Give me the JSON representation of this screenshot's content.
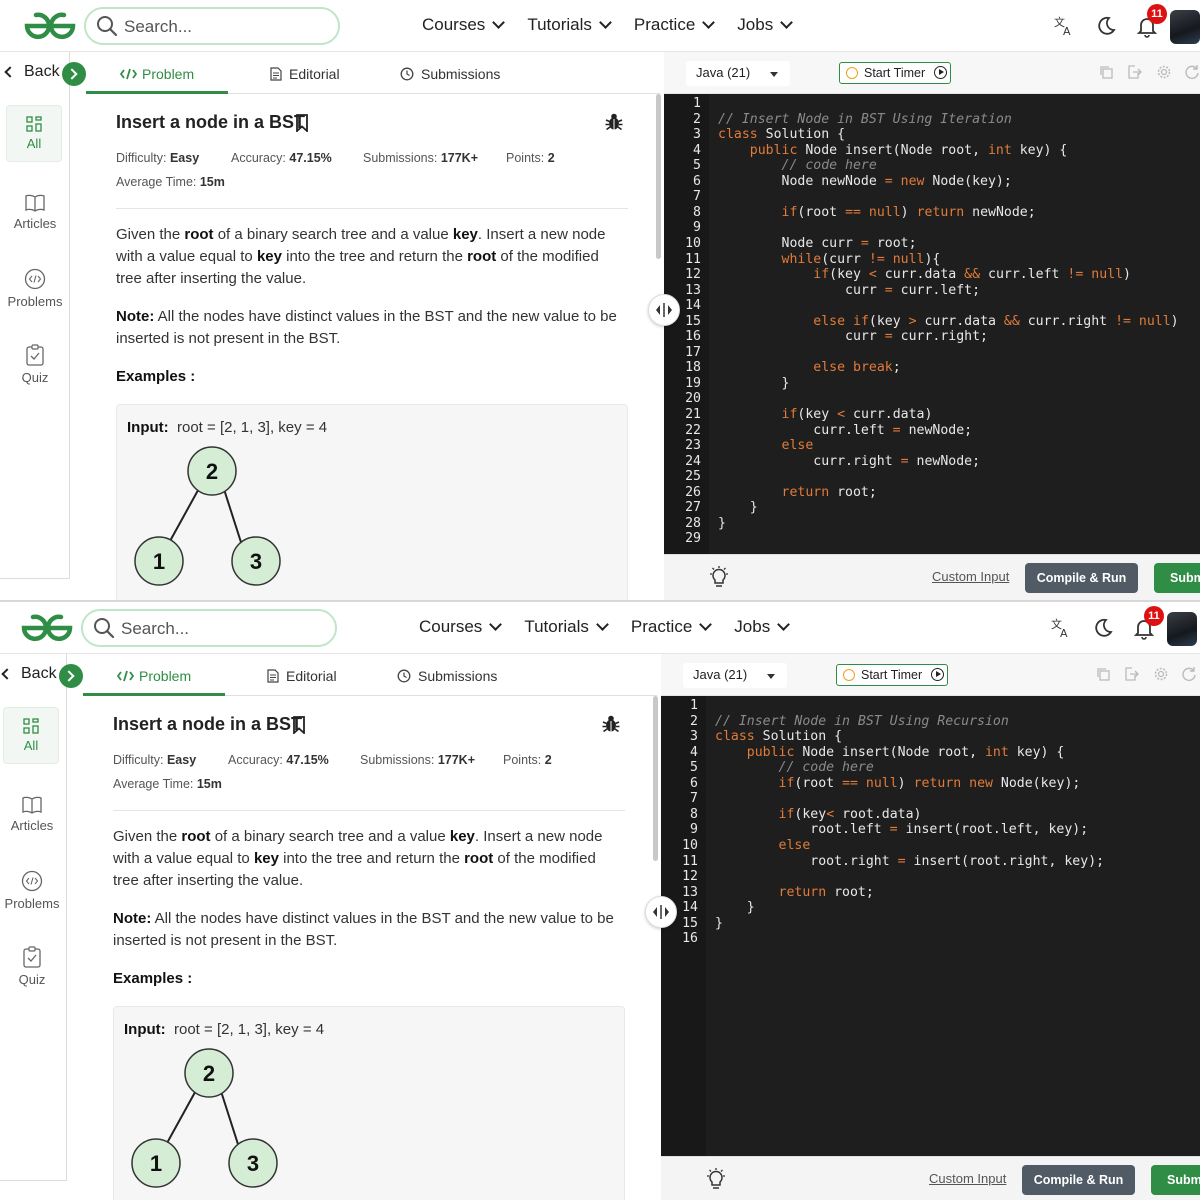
{
  "shots": [
    {
      "header": {
        "search_placeholder": "Search...",
        "nav": [
          "Courses",
          "Tutorials",
          "Practice",
          "Jobs"
        ],
        "notification_count": "11"
      },
      "sidebar": {
        "back_label": "Back",
        "items": [
          "All",
          "Articles",
          "Problems",
          "Quiz"
        ]
      },
      "tabs": [
        "Problem",
        "Editorial",
        "Submissions"
      ],
      "problem": {
        "title": "Insert a node in a BST",
        "difficulty_label": "Difficulty:",
        "difficulty": "Easy",
        "accuracy_label": "Accuracy:",
        "accuracy": "47.15%",
        "submissions_label": "Submissions:",
        "submissions": "177K+",
        "points_label": "Points:",
        "points": "2",
        "avg_time_label": "Average Time:",
        "avg_time": "15m",
        "desc": [
          "Given the ",
          "root",
          " of a binary search tree and a value ",
          "key",
          ". Insert a new node with a value equal to ",
          "key",
          " into the tree and return the ",
          "root",
          " of the modified tree after inserting the value."
        ],
        "note_label": "Note:",
        "note": " All the nodes have distinct values in the BST and the new value to be inserted is not present in the BST.",
        "examples_label": "Examples :",
        "example_input_label": "Input:",
        "example_input": "root = [2, 1, 3], key = 4",
        "tree_nodes": [
          "2",
          "1",
          "3"
        ]
      },
      "editor": {
        "language": "Java (21)",
        "timer_label": "Start Timer",
        "custom_input": "Custom Input",
        "compile_run": "Compile & Run",
        "submit": "Submit",
        "code": [
          "",
          "// Insert Node in BST Using Iteration",
          "class Solution {",
          "    public Node insert(Node root, int key) {",
          "        // code here",
          "        Node newNode = new Node(key);",
          "",
          "        if(root == null) return newNode;",
          "",
          "        Node curr = root;",
          "        while(curr != null){",
          "            if(key < curr.data && curr.left != null)",
          "                curr = curr.left;",
          "",
          "            else if(key > curr.data && curr.right != null)",
          "                curr = curr.right;",
          "",
          "            else break;",
          "        }",
          "",
          "        if(key < curr.data)",
          "            curr.left = newNode;",
          "        else",
          "            curr.right = newNode;",
          "",
          "        return root;",
          "    }",
          "}",
          ""
        ]
      }
    },
    {
      "header": {
        "search_placeholder": "Search...",
        "nav": [
          "Courses",
          "Tutorials",
          "Practice",
          "Jobs"
        ],
        "notification_count": "11"
      },
      "sidebar": {
        "back_label": "Back",
        "items": [
          "All",
          "Articles",
          "Problems",
          "Quiz"
        ]
      },
      "tabs": [
        "Problem",
        "Editorial",
        "Submissions"
      ],
      "problem": {
        "title": "Insert a node in a BST",
        "difficulty_label": "Difficulty:",
        "difficulty": "Easy",
        "accuracy_label": "Accuracy:",
        "accuracy": "47.15%",
        "submissions_label": "Submissions:",
        "submissions": "177K+",
        "points_label": "Points:",
        "points": "2",
        "avg_time_label": "Average Time:",
        "avg_time": "15m",
        "desc": [
          "Given the ",
          "root",
          " of a binary search tree and a value ",
          "key",
          ". Insert a new node with a value equal to ",
          "key",
          " into the tree and return the ",
          "root",
          " of the modified tree after inserting the value."
        ],
        "note_label": "Note:",
        "note": " All the nodes have distinct values in the BST and the new value to be inserted is not present in the BST.",
        "examples_label": "Examples :",
        "example_input_label": "Input:",
        "example_input": "root = [2, 1, 3], key = 4",
        "tree_nodes": [
          "2",
          "1",
          "3"
        ]
      },
      "editor": {
        "language": "Java (21)",
        "timer_label": "Start Timer",
        "custom_input": "Custom Input",
        "compile_run": "Compile & Run",
        "submit": "Submit",
        "code": [
          "",
          "// Insert Node in BST Using Recursion",
          "class Solution {",
          "    public Node insert(Node root, int key) {",
          "        // code here",
          "        if(root == null) return new Node(key);",
          "",
          "        if(key< root.data)",
          "            root.left = insert(root.left, key);",
          "        else",
          "            root.right = insert(root.right, key);",
          "",
          "        return root;",
          "    }",
          "}",
          ""
        ]
      }
    }
  ]
}
